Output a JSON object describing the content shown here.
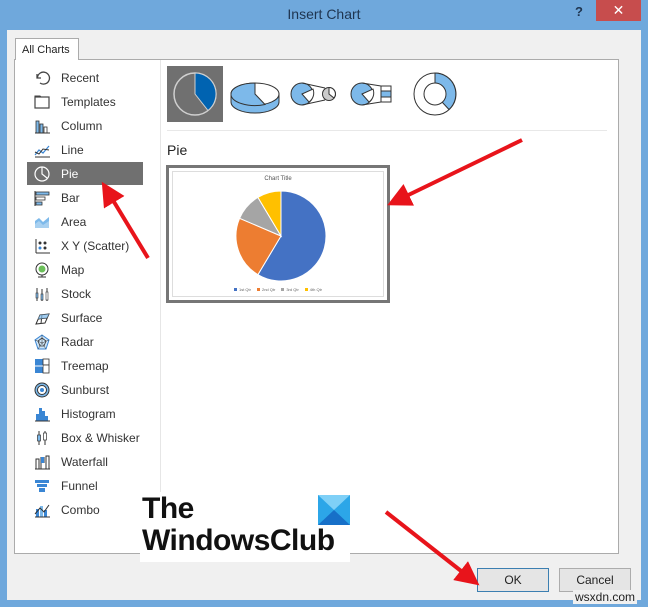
{
  "dialog": {
    "title": "Insert Chart",
    "help_label": "?",
    "close_label": "✕"
  },
  "tabs": [
    {
      "label": "All Charts"
    }
  ],
  "sidebar": {
    "items": [
      {
        "label": "Recent",
        "icon": "recent-icon"
      },
      {
        "label": "Templates",
        "icon": "templates-icon"
      },
      {
        "label": "Column",
        "icon": "column-chart-icon"
      },
      {
        "label": "Line",
        "icon": "line-chart-icon"
      },
      {
        "label": "Pie",
        "icon": "pie-chart-icon",
        "selected": true
      },
      {
        "label": "Bar",
        "icon": "bar-chart-icon"
      },
      {
        "label": "Area",
        "icon": "area-chart-icon"
      },
      {
        "label": "X Y (Scatter)",
        "icon": "scatter-chart-icon"
      },
      {
        "label": "Map",
        "icon": "map-chart-icon"
      },
      {
        "label": "Stock",
        "icon": "stock-chart-icon"
      },
      {
        "label": "Surface",
        "icon": "surface-chart-icon"
      },
      {
        "label": "Radar",
        "icon": "radar-chart-icon"
      },
      {
        "label": "Treemap",
        "icon": "treemap-chart-icon"
      },
      {
        "label": "Sunburst",
        "icon": "sunburst-chart-icon"
      },
      {
        "label": "Histogram",
        "icon": "histogram-chart-icon"
      },
      {
        "label": "Box & Whisker",
        "icon": "box-whisker-chart-icon"
      },
      {
        "label": "Waterfall",
        "icon": "waterfall-chart-icon"
      },
      {
        "label": "Funnel",
        "icon": "funnel-chart-icon"
      },
      {
        "label": "Combo",
        "icon": "combo-chart-icon"
      }
    ]
  },
  "subtypes": [
    {
      "name": "pie",
      "selected": true
    },
    {
      "name": "3-d-pie"
    },
    {
      "name": "pie-of-pie"
    },
    {
      "name": "bar-of-pie"
    },
    {
      "name": "doughnut"
    }
  ],
  "main": {
    "type_title": "Pie"
  },
  "colors": {
    "title_bar": "#6fa8dc",
    "close": "#c74d4d",
    "selected": "#707070",
    "accent_blue": "#0063b1",
    "icon_blue": "#7db9ea",
    "arrow": "#e8141b"
  },
  "chart_data": {
    "type": "pie",
    "title": "Chart Title",
    "categories": [
      "1st Qtr",
      "2nd Qtr",
      "3rd Qtr",
      "4th Qtr"
    ],
    "values": [
      8.2,
      3.2,
      1.4,
      1.2
    ],
    "colors": [
      "#4472c4",
      "#ed7d31",
      "#a5a5a5",
      "#ffc000"
    ],
    "legend": "bottom"
  },
  "footer": {
    "ok_label": "OK",
    "cancel_label": "Cancel"
  },
  "watermark": {
    "line1": "The",
    "line2": "WindowsClub",
    "site": "wsxdn.com"
  }
}
